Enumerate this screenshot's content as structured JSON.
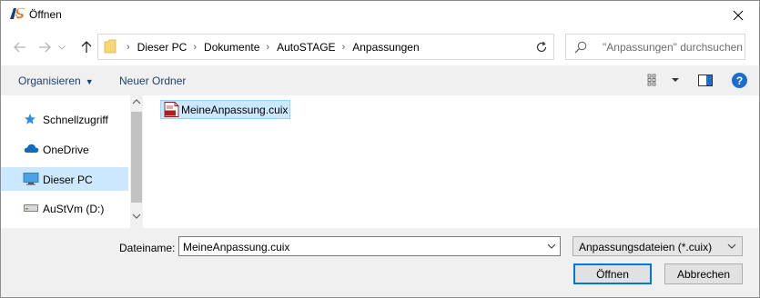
{
  "window": {
    "title": "Öffnen"
  },
  "address": {
    "crumbs": [
      "Dieser PC",
      "Dokumente",
      "AutoSTAGE",
      "Anpassungen"
    ]
  },
  "search": {
    "placeholder": "\"Anpassungen\" durchsuchen"
  },
  "toolbar": {
    "organize": "Organisieren",
    "new_folder": "Neuer Ordner",
    "help": "?"
  },
  "nav": {
    "items": [
      {
        "label": "Schnellzugriff",
        "icon": "star-icon",
        "selected": false
      },
      {
        "label": "OneDrive",
        "icon": "cloud-icon",
        "selected": false
      },
      {
        "label": "Dieser PC",
        "icon": "computer-icon",
        "selected": true
      },
      {
        "label": "AuStVm (D:)",
        "icon": "drive-icon",
        "selected": false
      }
    ]
  },
  "files": [
    {
      "name": "MeineAnpassung.cuix",
      "icon": "cuix-file-icon",
      "icon_text": "CUIX",
      "selected": true
    }
  ],
  "bottom": {
    "filename_label": "Dateiname:",
    "filename_value": "MeineAnpassung.cuix",
    "filetype_value": "Anpassungsdateien (*.cuix)",
    "open_label": "Öffnen",
    "cancel_label": "Abbrechen"
  },
  "colors": {
    "accent": "#0078d7",
    "selection": "#cce8ff",
    "toolbar_bg": "#f0f0f0",
    "help": "#1c6dd0"
  }
}
